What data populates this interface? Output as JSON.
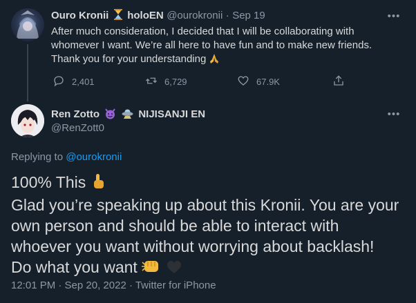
{
  "original_tweet": {
    "display_name": "Ouro Kronii",
    "name_suffix": "holoEN",
    "handle": "@ourokronii",
    "separator": "·",
    "date": "Sep 19",
    "text_line1": "After much consideration, I decided that I will be collaborating with",
    "text_line2": "whomever I want. We’re all here to have fun and to make new friends.",
    "text_line3": "Thank you for your understanding",
    "actions": {
      "replies": "2,401",
      "retweets": "6,729",
      "likes": "67.9K"
    }
  },
  "reply_tweet": {
    "display_name": "Ren Zotto",
    "name_suffix": "NIJISANJI EN",
    "handle": "@RenZott0",
    "replying_to_prefix": "Replying to",
    "replying_to_handle": "@ourokronii",
    "line1": "100% This",
    "line2": "Glad you’re speaking up about this Kronii. You are your",
    "line3": "own person and should be able to interact with",
    "line4": "whoever you want without worrying about backlash!",
    "line5": "Do what you want",
    "timestamp": "12:01 PM · Sep 20, 2022 · Twitter for iPhone"
  },
  "icons": {
    "more": "more-icon",
    "reply": "reply-icon",
    "retweet": "retweet-icon",
    "like": "heart-icon",
    "share": "share-icon"
  },
  "colors": {
    "background": "#15202b",
    "text": "#d9d9d9",
    "muted": "#8b98a5",
    "accent": "#1d9bf0"
  }
}
